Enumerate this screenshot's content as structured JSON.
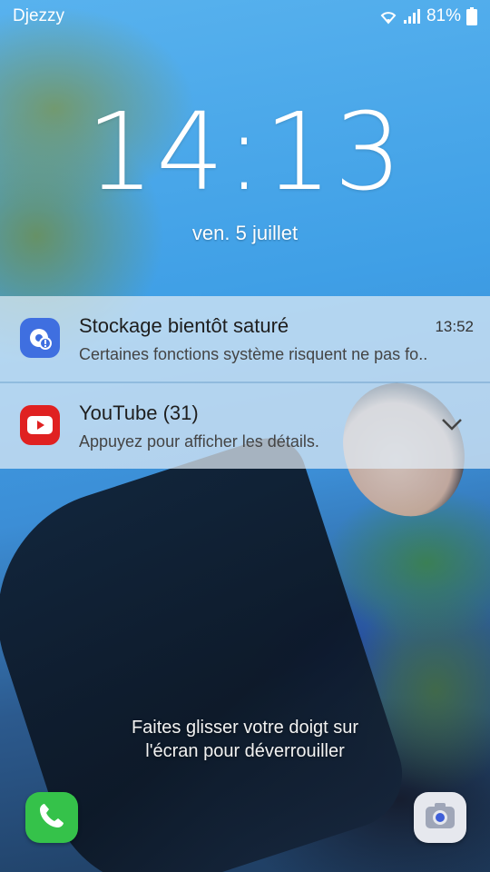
{
  "status_bar": {
    "carrier": "Djezzy",
    "battery_percent": "81%",
    "icons": [
      "wifi-icon",
      "signal-icon",
      "battery-icon"
    ]
  },
  "lock_screen": {
    "time": "14:13",
    "date": "ven. 5 juillet",
    "unlock_hint_line1": "Faites glisser votre doigt sur",
    "unlock_hint_line2": "l'écran pour déverrouiller"
  },
  "notifications": [
    {
      "app_icon": "storage-warning-icon",
      "title": "Stockage bientôt saturé",
      "text": "Certaines fonctions système risquent ne pas fo..",
      "time": "13:52",
      "accent": "#3f6fe0"
    },
    {
      "app_icon": "youtube-icon",
      "title": "YouTube (31)",
      "text": "Appuyez pour afficher les détails.",
      "accent": "#e02121"
    }
  ],
  "shortcuts": {
    "left": "phone-icon",
    "right": "camera-icon"
  },
  "colors": {
    "phone": "#35c24a",
    "camera": "#e6e8ee"
  }
}
